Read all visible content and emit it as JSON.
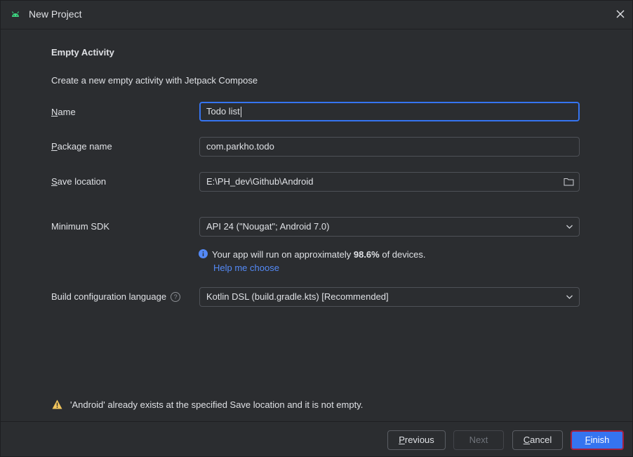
{
  "window": {
    "title": "New Project",
    "app_icon": "android-icon",
    "close_icon": "close-icon"
  },
  "form": {
    "heading": "Empty Activity",
    "description": "Create a new empty activity with Jetpack Compose",
    "name": {
      "label_first": "N",
      "label_rest": "ame",
      "value": "Todo list"
    },
    "package": {
      "label_first": "P",
      "label_rest": "ackage name",
      "value": "com.parkho.todo"
    },
    "save_location": {
      "label_first": "S",
      "label_rest": "ave location",
      "value": "E:\\PH_dev\\Github\\Android",
      "icon": "folder-icon"
    },
    "min_sdk": {
      "label": "Minimum SDK",
      "value": "API 24 (\"Nougat\"; Android 7.0)"
    },
    "sdk_info": {
      "prefix": "Your app will run on approximately ",
      "percent": "98.6%",
      "suffix": " of devices.",
      "link": "Help me choose",
      "icon": "info-icon"
    },
    "build_lang": {
      "label": "Build configuration language",
      "help": "?",
      "value": "Kotlin DSL (build.gradle.kts) [Recommended]"
    }
  },
  "warning": {
    "icon": "warning-icon",
    "text": "'Android' already exists at the specified Save location and it is not empty."
  },
  "footer": {
    "previous": {
      "first": "P",
      "rest": "revious"
    },
    "next": "Next",
    "cancel": {
      "first": "C",
      "rest": "ancel"
    },
    "finish": {
      "first": "F",
      "rest": "inish"
    }
  },
  "colors": {
    "background": "#2b2d30",
    "accent": "#3574f0",
    "link": "#548af7",
    "warning": "#f2c55c",
    "focus_outline": "#a3203f"
  }
}
